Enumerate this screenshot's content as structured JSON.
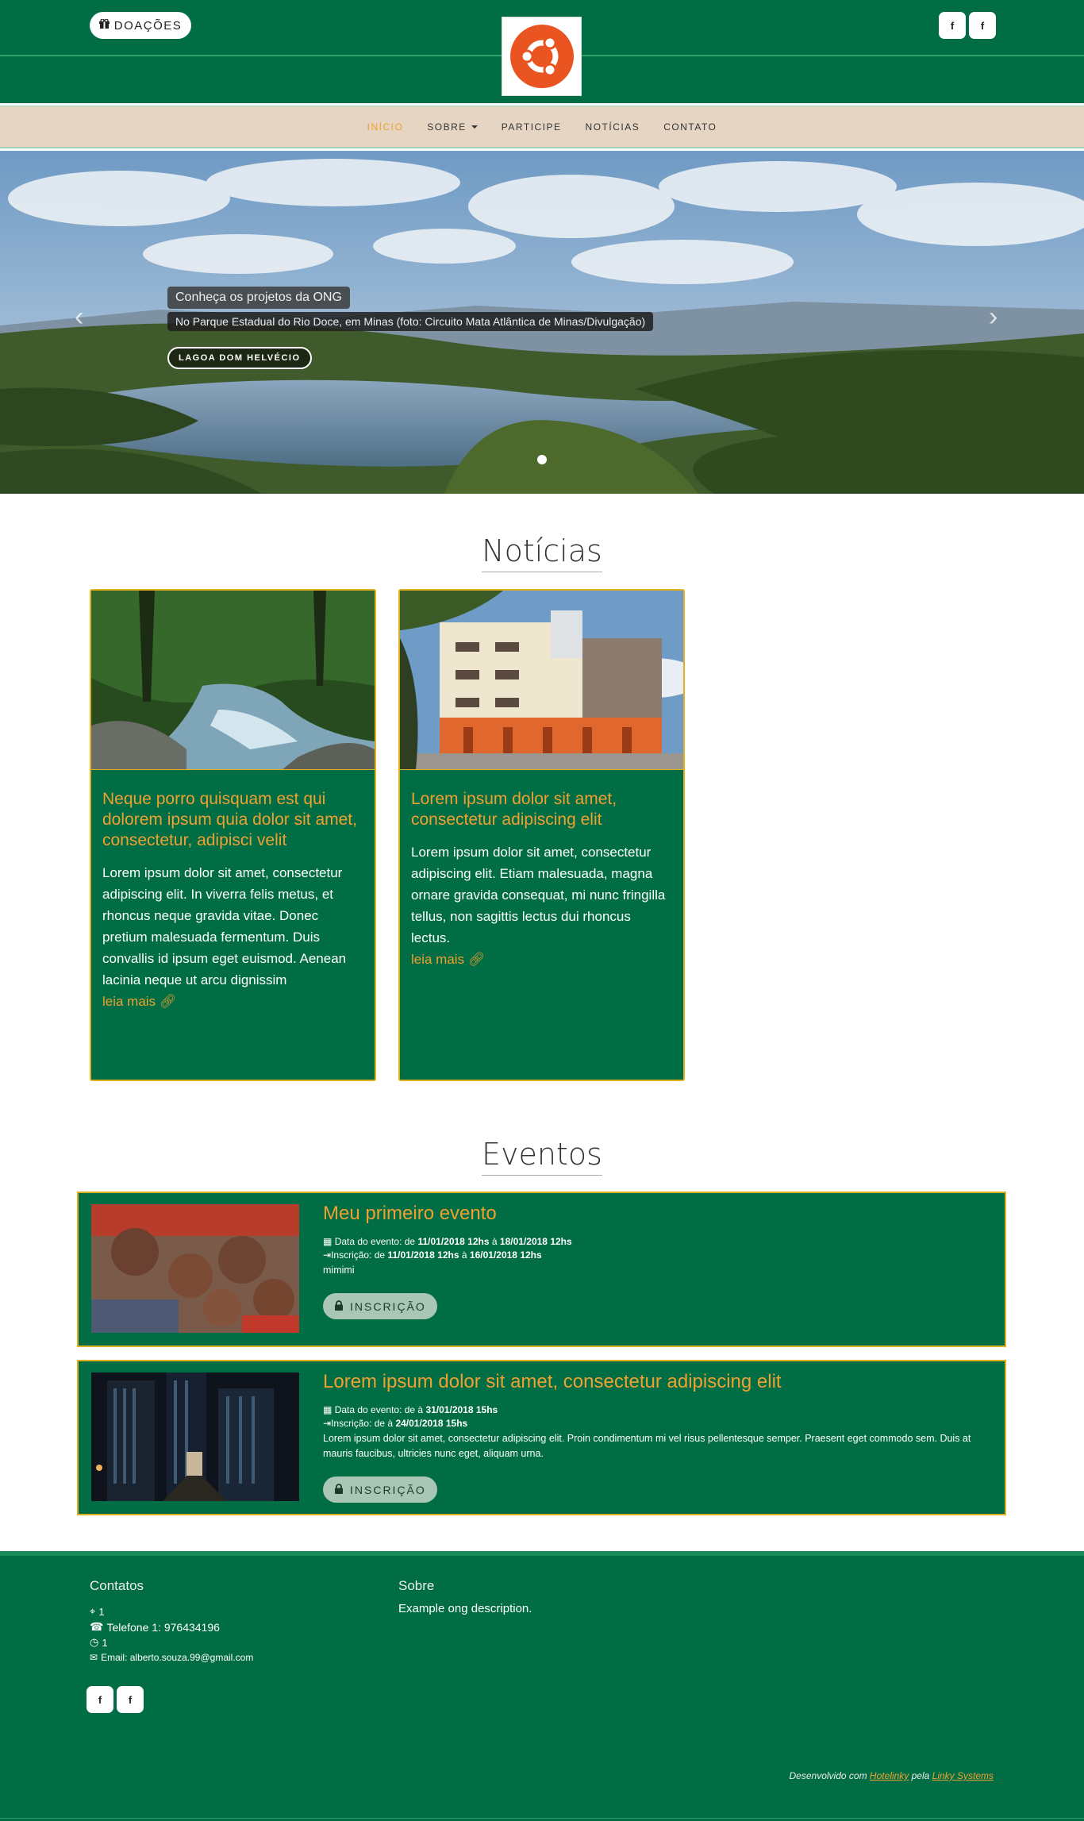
{
  "header": {
    "donate_label": "DOAÇÕES",
    "donate_icon": "gift-icon",
    "logo": "ubuntu-logo",
    "social_top": [
      "f",
      "f"
    ]
  },
  "nav": {
    "items": [
      {
        "label": "INÍCIO",
        "active": true
      },
      {
        "label": "SOBRE",
        "dropdown": true
      },
      {
        "label": "PARTICIPE"
      },
      {
        "label": "NOTÍCIAS"
      },
      {
        "label": "CONTATO"
      }
    ]
  },
  "hero": {
    "caption_title": "Conheça os projetos da ONG",
    "caption_text": "No Parque Estadual do Rio Doce, em Minas (foto: Circuito Mata Atlântica de Minas/Divulgação)",
    "button_label": "LAGOA DOM HELVÉCIO",
    "prev": "‹",
    "next": "›"
  },
  "news": {
    "section_title": "Notícias",
    "cards": [
      {
        "title": "Neque porro quisquam est qui dolorem ipsum quia dolor sit amet, consectetur, adipisci velit",
        "body": "Lorem ipsum dolor sit amet, consectetur adipiscing elit. In viverra felis metus, et rhoncus neque gravida vitae. Donec pretium malesuada fermentum. Duis convallis id ipsum eget euismod. Aenean lacinia neque ut arcu dignissim",
        "more": "leia mais"
      },
      {
        "title": "Lorem ipsum dolor sit amet, consectetur adipiscing elit",
        "body": "Lorem ipsum dolor sit amet, consectetur adipiscing elit. Etiam malesuada, magna ornare gravida consequat, mi nunc fringilla tellus, non sagittis lectus dui rhoncus lectus.",
        "more": "leia mais"
      }
    ]
  },
  "events": {
    "section_title": "Eventos",
    "items": [
      {
        "title": "Meu primeiro evento",
        "date_label": "Data do evento: de",
        "date_from": "11/01/2018 12hs",
        "date_sep": "à",
        "date_to": "18/01/2018 12hs",
        "reg_label": "Inscrição: de",
        "reg_from": "11/01/2018 12hs",
        "reg_sep": "à",
        "reg_to": "16/01/2018 12hs",
        "desc": "mimimi",
        "button": "INSCRIÇÃO"
      },
      {
        "title": "Lorem ipsum dolor sit amet, consectetur adipiscing elit",
        "date_label": "Data do evento: de à",
        "date_from": "",
        "date_sep": "",
        "date_to": "31/01/2018 15hs",
        "reg_label": "Inscrição: de à",
        "reg_from": "",
        "reg_sep": "",
        "reg_to": "24/01/2018 15hs",
        "desc": "Lorem ipsum dolor sit amet, consectetur adipiscing elit. Proin condimentum mi vel risus pellentesque semper. Praesent eget commodo sem. Duis at mauris faucibus, ultricies nunc eget, aliquam urna.",
        "button": "INSCRIÇÃO"
      }
    ]
  },
  "footer": {
    "contacts_title": "Contatos",
    "address": "1",
    "phone": "Telefone 1: 976434196",
    "hours": "1",
    "email": "Email: alberto.souza.99@gmail.com",
    "about_title": "Sobre",
    "about_text": "Example ong description.",
    "social": [
      "f",
      "f"
    ],
    "credit_prefix": "Desenvolvido com",
    "credit_link1": "Hotelinky",
    "credit_mid": "pela",
    "credit_link2": "Linky Systems"
  },
  "colors": {
    "primary_green": "#006d45",
    "accent_orange": "#f0a030",
    "nav_bg": "#e6d5c3",
    "gold_border": "#e0b020"
  }
}
